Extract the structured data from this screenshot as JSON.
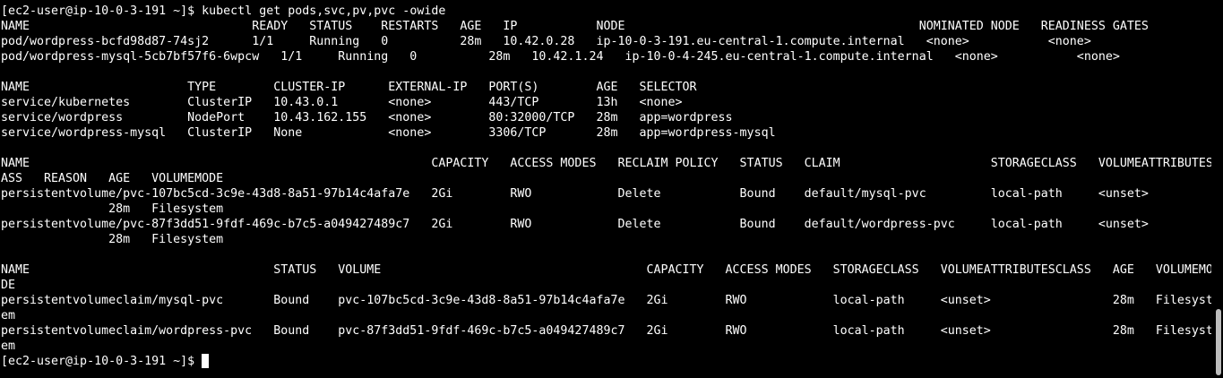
{
  "terminal": {
    "prompt": "[ec2-user@ip-10-0-3-191 ~]$ ",
    "command": "kubectl get pods,svc,pv,pvc -owide",
    "lines": [
      "NAME                               READY   STATUS    RESTARTS   AGE   IP           NODE                                         NOMINATED NODE   READINESS GATES",
      "pod/wordpress-bcfd98d87-74sj2      1/1     Running   0          28m   10.42.0.28   ip-10-0-3-191.eu-central-1.compute.internal   <none>           <none>",
      "pod/wordpress-mysql-5cb7bf57f6-6wpcw   1/1     Running   0          28m   10.42.1.24   ip-10-0-4-245.eu-central-1.compute.internal   <none>           <none>",
      "",
      "NAME                      TYPE        CLUSTER-IP      EXTERNAL-IP   PORT(S)        AGE   SELECTOR",
      "service/kubernetes        ClusterIP   10.43.0.1       <none>        443/TCP        13h   <none>",
      "service/wordpress         NodePort    10.43.162.155   <none>        80:32000/TCP   28m   app=wordpress",
      "service/wordpress-mysql   ClusterIP   None            <none>        3306/TCP       28m   app=wordpress-mysql",
      "",
      "NAME                                                        CAPACITY   ACCESS MODES   RECLAIM POLICY   STATUS   CLAIM                     STORAGECLASS   VOLUMEATTRIBUTESCL",
      "ASS   REASON   AGE   VOLUMEMODE",
      "persistentvolume/pvc-107bc5cd-3c9e-43d8-8a51-97b14c4afa7e   2Gi        RWO            Delete           Bound    default/mysql-pvc         local-path     <unset>",
      "               28m   Filesystem",
      "persistentvolume/pvc-87f3dd51-9fdf-469c-b7c5-a049427489c7   2Gi        RWO            Delete           Bound    default/wordpress-pvc     local-path     <unset>",
      "               28m   Filesystem",
      "",
      "NAME                                  STATUS   VOLUME                                     CAPACITY   ACCESS MODES   STORAGECLASS   VOLUMEATTRIBUTESCLASS   AGE   VOLUMEMO",
      "DE",
      "persistentvolumeclaim/mysql-pvc       Bound    pvc-107bc5cd-3c9e-43d8-8a51-97b14c4afa7e   2Gi        RWO            local-path     <unset>                 28m   Filesyst",
      "em",
      "persistentvolumeclaim/wordpress-pvc   Bound    pvc-87f3dd51-9fdf-469c-b7c5-a049427489c7   2Gi        RWO            local-path     <unset>                 28m   Filesyst",
      "em"
    ],
    "final_prompt": "[ec2-user@ip-10-0-3-191 ~]$ "
  }
}
